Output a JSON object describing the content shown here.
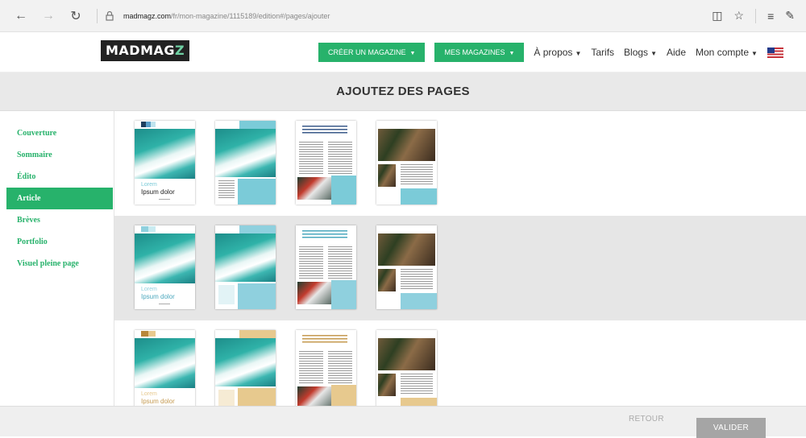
{
  "browser": {
    "url_host": "madmagz.com",
    "url_path": "/fr/mon-magazine/1115189/edition#/pages/ajouter",
    "icons": [
      "back-arrow-icon",
      "forward-arrow-icon",
      "refresh-icon",
      "lock-icon",
      "reading-view-icon",
      "favorite-star-icon",
      "hub-icon",
      "web-note-icon"
    ]
  },
  "header": {
    "logo_main": "MADMAG",
    "logo_z": "Z",
    "create_btn": "CRÉER UN MAGAZINE",
    "my_mags_btn": "MES MAGAZINES",
    "links": [
      "À propos",
      "Tarifs",
      "Blogs",
      "Aide",
      "Mon compte"
    ],
    "accent": "#27b26b"
  },
  "title": "AJOUTEZ DES PAGES",
  "sidebar": {
    "items": [
      "Couverture",
      "Sommaire",
      "Édito",
      "Article",
      "Brèves",
      "Portfolio",
      "Visuel pleine page"
    ],
    "active": "Article"
  },
  "templates": {
    "cover_lorem": "Lorem",
    "cover_ipsum": "Ipsum dolor",
    "row_colors": [
      "#7bcbd8",
      "#8fd0de",
      "#e7c98e"
    ]
  },
  "footer": {
    "back": "RETOUR",
    "validate": "VALIDER"
  }
}
